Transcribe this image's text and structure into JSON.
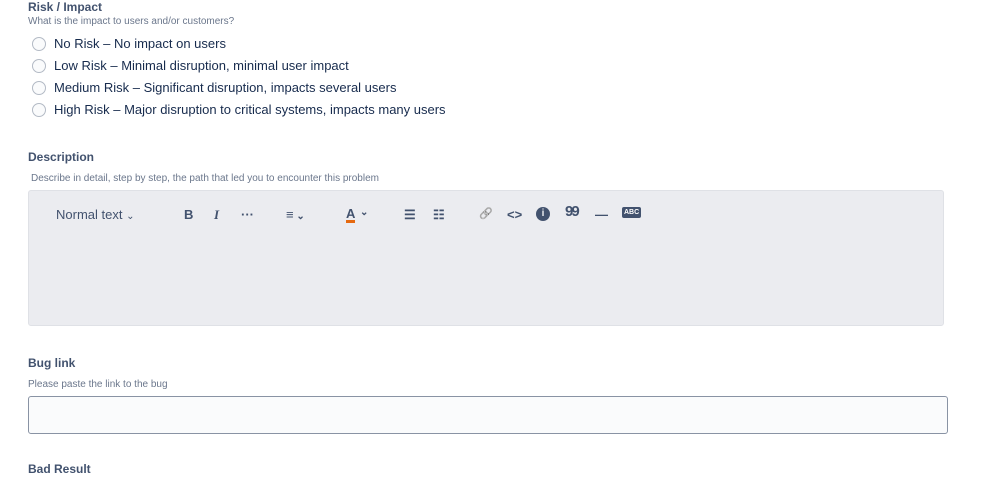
{
  "risk": {
    "label": "Risk / Impact",
    "help": "What is the impact to users and/or customers?",
    "options": [
      "No Risk – No impact on users",
      "Low Risk – Minimal disruption, minimal user impact",
      "Medium Risk – Significant disruption, impacts several users",
      "High Risk – Major disruption to critical systems, impacts many users"
    ]
  },
  "description": {
    "label": "Description",
    "help": "Describe in detail, step by step, the path that led you to encounter this problem",
    "toolbar": {
      "text_style": "Normal text",
      "bold": "B",
      "italic": "I",
      "more": "···",
      "align": "≡",
      "color": "A",
      "bullet": "☰",
      "numbered": "☷",
      "link": "🔗",
      "code": "<>",
      "info": "i",
      "quote": "99",
      "rule": "—",
      "spell": "ABC"
    }
  },
  "bug_link": {
    "label": "Bug link",
    "help": "Please paste the link to the bug",
    "value": ""
  },
  "bad_result": {
    "label": "Bad Result"
  }
}
